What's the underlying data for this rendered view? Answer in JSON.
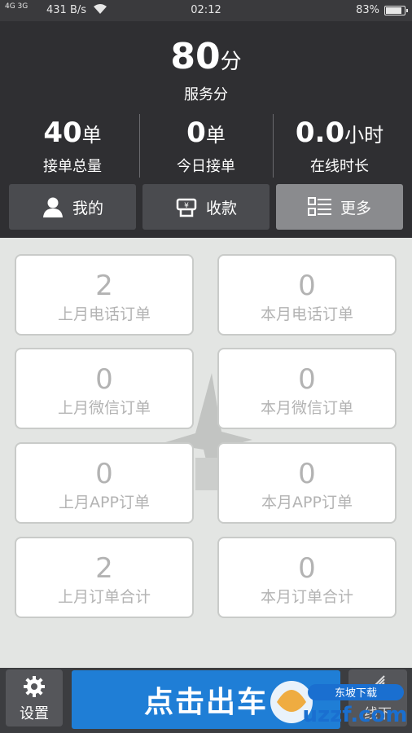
{
  "status_bar": {
    "signal": "4G 3G",
    "speed": "431 B/s",
    "time": "02:12",
    "battery": "83%"
  },
  "header": {
    "score_value": "80",
    "score_unit": "分",
    "score_label": "服务分",
    "stats": [
      {
        "value": "40",
        "unit": "单",
        "label": "接单总量"
      },
      {
        "value": "0",
        "unit": "单",
        "label": "今日接单"
      },
      {
        "value": "0.0",
        "unit": "小时",
        "label": "在线时长"
      }
    ],
    "actions": [
      {
        "label": "我的",
        "icon": "person-icon"
      },
      {
        "label": "收款",
        "icon": "payment-icon"
      },
      {
        "label": "更多",
        "icon": "list-icon"
      }
    ]
  },
  "grid": {
    "cards": [
      {
        "value": "2",
        "label": "上月电话订单"
      },
      {
        "value": "0",
        "label": "本月电话订单"
      },
      {
        "value": "0",
        "label": "上月微信订单"
      },
      {
        "value": "0",
        "label": "本月微信订单"
      },
      {
        "value": "0",
        "label": "上月APP订单"
      },
      {
        "value": "0",
        "label": "本月APP订单"
      },
      {
        "value": "2",
        "label": "上月订单合计"
      },
      {
        "value": "0",
        "label": "本月订单合计"
      }
    ]
  },
  "bottom_bar": {
    "settings_label": "设置",
    "go_label": "点击出车",
    "right_label": "线下"
  },
  "watermark_logo": {
    "text": "uzzf.com",
    "sub": "东坡下载"
  },
  "colors": {
    "header_bg": "#2f2f32",
    "grid_bg": "#e3e5e3",
    "go_button": "#1f7ed6",
    "card_text": "#b3b3b3"
  }
}
